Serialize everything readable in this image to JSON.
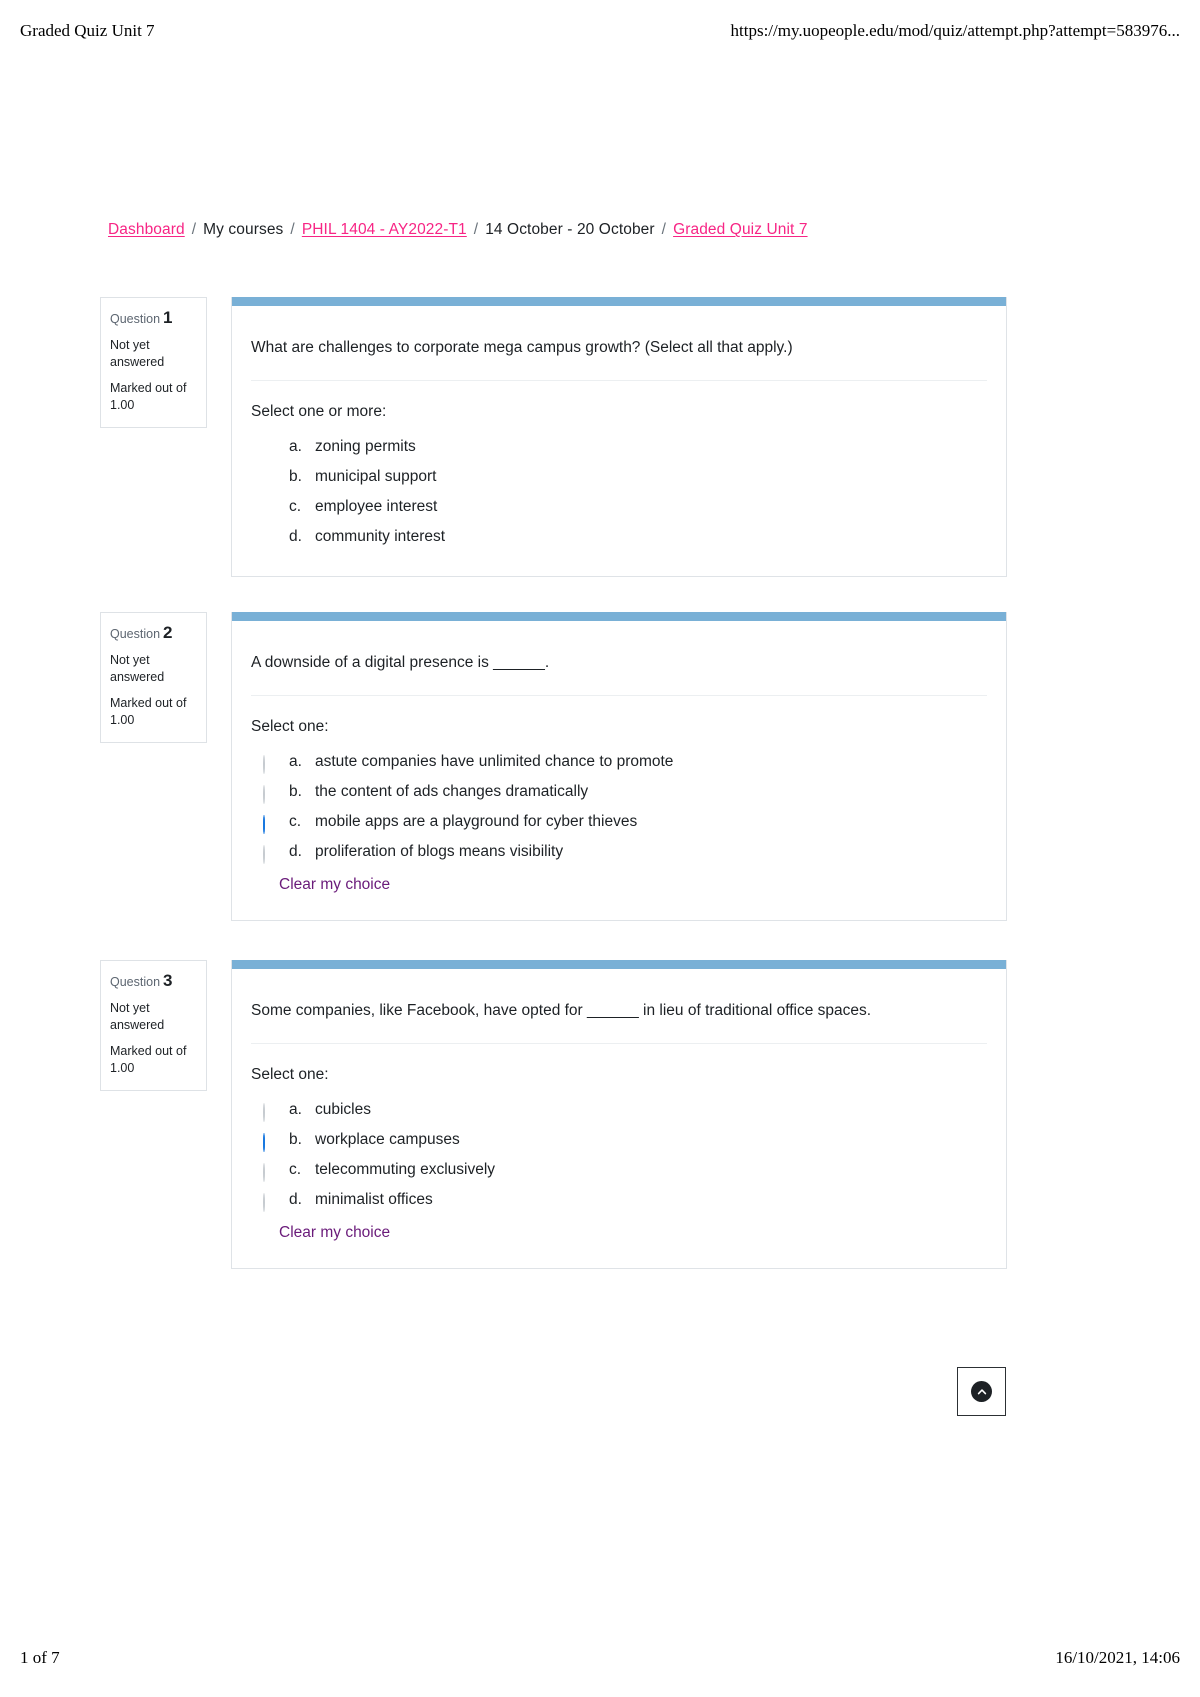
{
  "print": {
    "header_title": "Graded Quiz Unit 7",
    "header_url": "https://my.uopeople.edu/mod/quiz/attempt.php?attempt=583976...",
    "footer_page": "1 of 7",
    "footer_datetime": "16/10/2021, 14:06"
  },
  "breadcrumb": {
    "items": [
      {
        "label": "Dashboard",
        "link": true
      },
      {
        "label": "My courses",
        "link": false
      },
      {
        "label": "PHIL 1404 - AY2022-T1",
        "link": true
      },
      {
        "label": "14 October - 20 October",
        "link": false
      },
      {
        "label": "Graded Quiz Unit 7",
        "link": true
      }
    ],
    "separator": "/"
  },
  "labels": {
    "question_word": "Question",
    "not_yet_answered": "Not yet answered",
    "marked_out_of": "Marked out of",
    "clear_my_choice": "Clear my choice",
    "select_one": "Select one:",
    "select_one_or_more": "Select one or more:",
    "scroll_top": "scroll-to-top"
  },
  "colors": {
    "link_pink": "#f72585",
    "clear_purple": "#6a1b7a",
    "question_topbar": "#79b0d6",
    "checkbox_blue": "#4ba3f0",
    "radio_blue": "#1878e0"
  },
  "questions": [
    {
      "number": "1",
      "state": "Not yet answered",
      "marked_out_of_label": "Marked out of",
      "marked_out_of_value": "1.00",
      "text": "What are challenges to corporate mega campus growth? (Select all that apply.)",
      "select_label": "Select one or more:",
      "input_type": "checkbox",
      "show_clear": false,
      "options": [
        {
          "letter": "a.",
          "text": "zoning permits",
          "selected": true
        },
        {
          "letter": "b.",
          "text": "municipal support",
          "selected": true
        },
        {
          "letter": "c.",
          "text": "employee interest",
          "selected": true
        },
        {
          "letter": "d.",
          "text": "community interest",
          "selected": true
        }
      ]
    },
    {
      "number": "2",
      "state": "Not yet answered",
      "marked_out_of_label": "Marked out of",
      "marked_out_of_value": "1.00",
      "text": "A downside of a digital presence is ______.",
      "select_label": "Select one:",
      "input_type": "radio",
      "show_clear": true,
      "clear_label": "Clear my choice",
      "options": [
        {
          "letter": "a.",
          "text": "astute companies have unlimited chance to promote",
          "selected": false
        },
        {
          "letter": "b.",
          "text": "the content of ads changes dramatically",
          "selected": false
        },
        {
          "letter": "c.",
          "text": "mobile apps are a playground for cyber thieves",
          "selected": true
        },
        {
          "letter": "d.",
          "text": "proliferation of blogs means visibility",
          "selected": false
        }
      ]
    },
    {
      "number": "3",
      "state": "Not yet answered",
      "marked_out_of_label": "Marked out of",
      "marked_out_of_value": "1.00",
      "text": "Some companies, like Facebook, have opted for ______ in lieu of traditional office spaces.",
      "select_label": "Select one:",
      "input_type": "radio",
      "show_clear": true,
      "clear_label": "Clear my choice",
      "options": [
        {
          "letter": "a.",
          "text": "cubicles",
          "selected": false
        },
        {
          "letter": "b.",
          "text": "workplace campuses",
          "selected": true
        },
        {
          "letter": "c.",
          "text": "telecommuting exclusively",
          "selected": false
        },
        {
          "letter": "d.",
          "text": "minimalist offices",
          "selected": false
        }
      ]
    }
  ],
  "layout": {
    "question_tops": [
      297,
      612,
      960
    ]
  }
}
